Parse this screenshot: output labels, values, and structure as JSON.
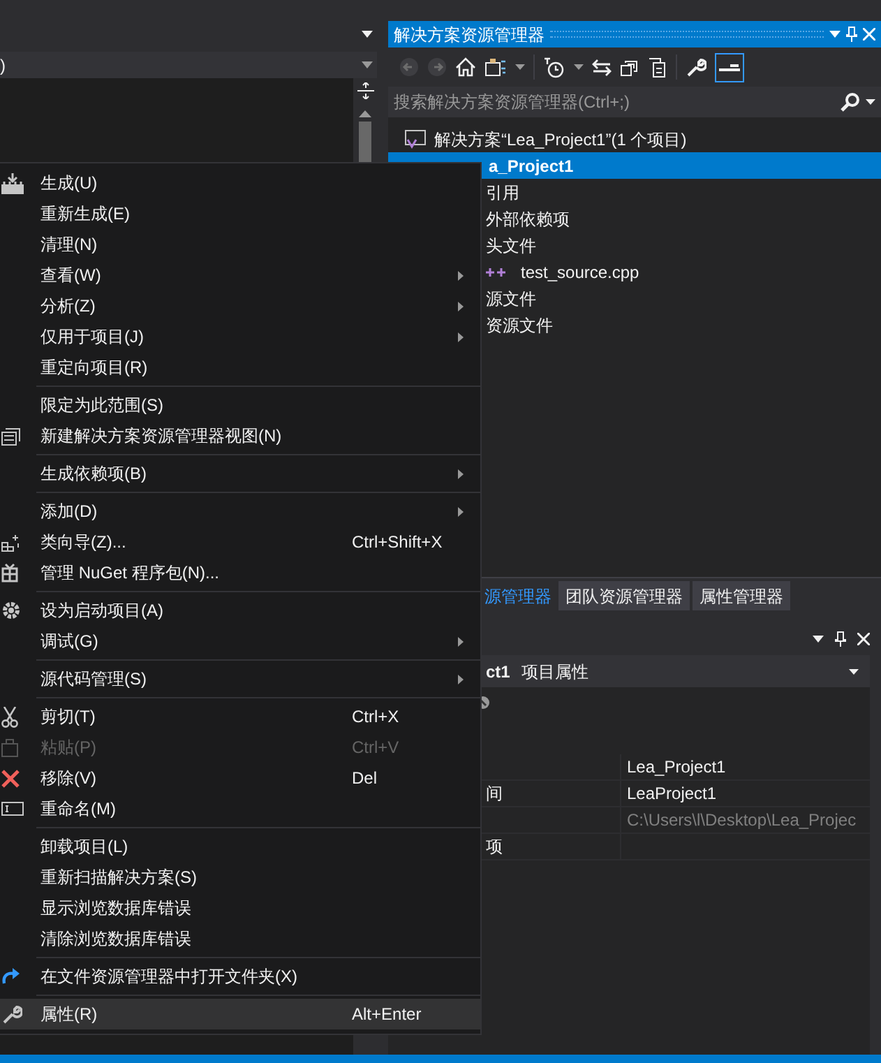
{
  "left_panel": {
    "dropdown_value": ")"
  },
  "solution_explorer": {
    "title": "解决方案资源管理器",
    "search": {
      "placeholder": "搜索解决方案资源管理器(Ctrl+;)"
    },
    "tree": [
      {
        "label": "解决方案“Lea_Project1”(1 个项目)",
        "selected": false,
        "children": [
          {
            "label": "a_Project1",
            "selected": true,
            "children": [
              {
                "label": "引用",
                "selected": false
              },
              {
                "label": "外部依赖项",
                "selected": false
              },
              {
                "label": "头文件",
                "selected": false,
                "children": [
                  {
                    "label": "test_source.cpp",
                    "selected": false
                  }
                ]
              },
              {
                "label": "源文件",
                "selected": false
              },
              {
                "label": "资源文件",
                "selected": false
              }
            ]
          }
        ]
      }
    ]
  },
  "tabs": [
    {
      "label": "源管理器",
      "selected": true
    },
    {
      "label": "团队资源管理器",
      "selected": false
    },
    {
      "label": "属性管理器",
      "selected": false
    }
  ],
  "properties": {
    "object": "ct1",
    "object_type": "项目属性",
    "rows": [
      {
        "value": "Lea_Project1",
        "disabled": false
      },
      {
        "name": "间",
        "value": "LeaProject1",
        "disabled": false
      },
      {
        "value": "C:\\Users\\l\\Desktop\\Lea_Projec",
        "disabled": true
      },
      {
        "name": "项",
        "disabled": false
      }
    ]
  },
  "context_menu": {
    "groups": [
      [
        {
          "label": "生成(U)",
          "submenu": false,
          "disabled": false,
          "selected": false
        },
        {
          "label": "重新生成(E)",
          "submenu": false,
          "disabled": false,
          "selected": false
        },
        {
          "label": "清理(N)",
          "submenu": false,
          "disabled": false,
          "selected": false
        },
        {
          "label": "查看(W)",
          "submenu": true,
          "disabled": false,
          "selected": false
        },
        {
          "label": "分析(Z)",
          "submenu": true,
          "disabled": false,
          "selected": false
        },
        {
          "label": "仅用于项目(J)",
          "submenu": true,
          "disabled": false,
          "selected": false
        },
        {
          "label": "重定向项目(R)",
          "submenu": false,
          "disabled": false,
          "selected": false
        }
      ],
      [
        {
          "label": "限定为此范围(S)",
          "submenu": false,
          "disabled": false,
          "selected": false
        },
        {
          "label": "新建解决方案资源管理器视图(N)",
          "submenu": false,
          "disabled": false,
          "selected": false
        }
      ],
      [
        {
          "label": "生成依赖项(B)",
          "submenu": true,
          "disabled": false,
          "selected": false
        }
      ],
      [
        {
          "label": "添加(D)",
          "submenu": true,
          "disabled": false,
          "selected": false
        },
        {
          "label": "类向导(Z)...",
          "shortcut": "Ctrl+Shift+X",
          "submenu": false,
          "disabled": false,
          "selected": false
        },
        {
          "label": "管理 NuGet 程序包(N)...",
          "submenu": false,
          "disabled": false,
          "selected": false
        }
      ],
      [
        {
          "label": "设为启动项目(A)",
          "submenu": false,
          "disabled": false,
          "selected": false
        },
        {
          "label": "调试(G)",
          "submenu": true,
          "disabled": false,
          "selected": false
        }
      ],
      [
        {
          "label": "源代码管理(S)",
          "submenu": true,
          "disabled": false,
          "selected": false
        }
      ],
      [
        {
          "label": "剪切(T)",
          "shortcut": "Ctrl+X",
          "submenu": false,
          "disabled": false,
          "selected": false
        },
        {
          "label": "粘贴(P)",
          "shortcut": "Ctrl+V",
          "submenu": false,
          "disabled": true,
          "selected": false
        },
        {
          "label": "移除(V)",
          "shortcut": "Del",
          "submenu": false,
          "disabled": false,
          "selected": false
        },
        {
          "label": "重命名(M)",
          "submenu": false,
          "disabled": false,
          "selected": false
        }
      ],
      [
        {
          "label": "卸载项目(L)",
          "submenu": false,
          "disabled": false,
          "selected": false
        },
        {
          "label": "重新扫描解决方案(S)",
          "submenu": false,
          "disabled": false,
          "selected": false
        },
        {
          "label": "显示浏览数据库错误",
          "submenu": false,
          "disabled": false,
          "selected": false
        },
        {
          "label": "清除浏览数据库错误",
          "submenu": false,
          "disabled": false,
          "selected": false
        }
      ],
      [
        {
          "label": "在文件资源管理器中打开文件夹(X)",
          "submenu": false,
          "disabled": false,
          "selected": false
        }
      ],
      [
        {
          "label": "属性(R)",
          "shortcut": "Alt+Enter",
          "submenu": false,
          "disabled": false,
          "selected": true
        }
      ]
    ]
  }
}
